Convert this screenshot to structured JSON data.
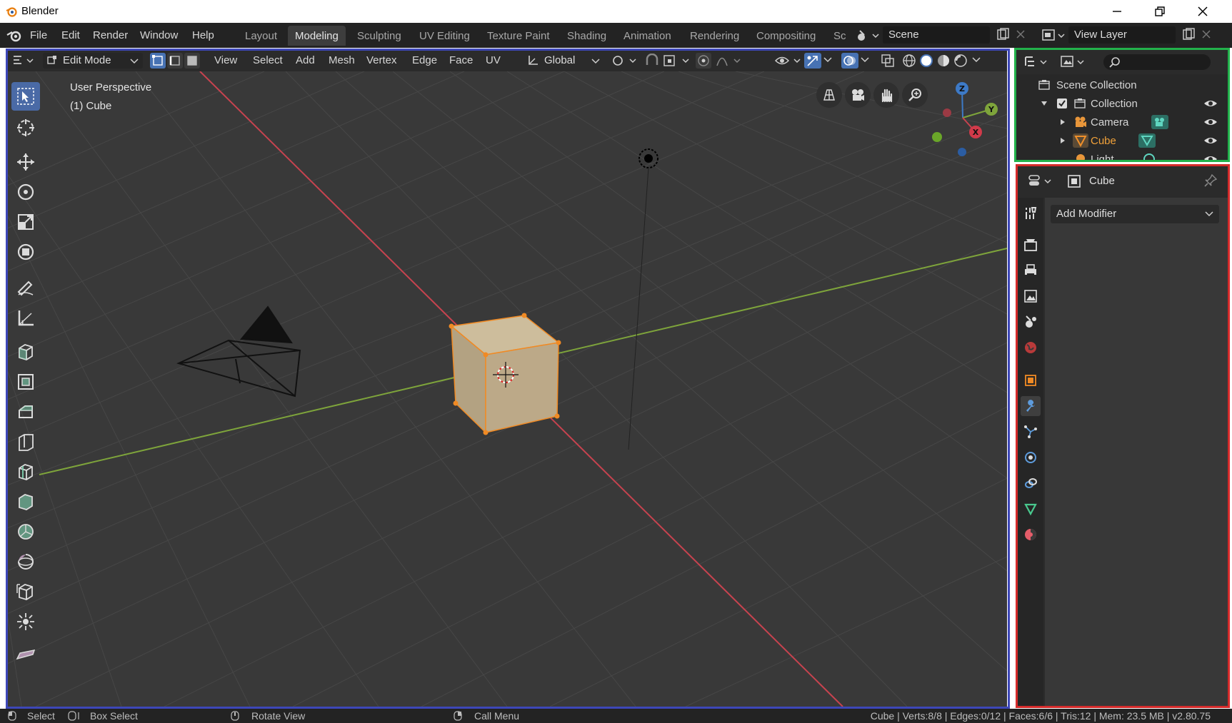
{
  "window": {
    "title": "Blender",
    "controls": [
      "minimize-icon",
      "restore-icon",
      "close-icon"
    ]
  },
  "menu": {
    "items": [
      "File",
      "Edit",
      "Render",
      "Window",
      "Help"
    ]
  },
  "workspaces": {
    "tabs": [
      "Layout",
      "Modeling",
      "Sculpting",
      "UV Editing",
      "Texture Paint",
      "Shading",
      "Animation",
      "Rendering",
      "Compositing",
      "Sc"
    ],
    "active": "Modeling"
  },
  "scene": {
    "name": "Scene"
  },
  "view_layer": {
    "name": "View Layer"
  },
  "viewport_header": {
    "mode": "Edit Mode",
    "menus": [
      "View",
      "Select",
      "Add",
      "Mesh",
      "Vertex",
      "Edge",
      "Face",
      "UV"
    ],
    "orientation": "Global"
  },
  "viewport": {
    "perspective": "User Perspective",
    "object_label": "(1) Cube",
    "gizmo_axes": [
      "Z",
      "Y",
      "X"
    ],
    "colors": {
      "background": "#393939",
      "x_axis": "#c7434f",
      "y_axis": "#7ea43b",
      "cube": "#b9a98a",
      "selection": "#f08a24",
      "frame": "#3d47b8"
    }
  },
  "outliner": {
    "root": "Scene Collection",
    "collection": "Collection",
    "objects": [
      "Camera",
      "Cube",
      "Light"
    ],
    "frame_color": "#22b24b"
  },
  "properties": {
    "object_name": "Cube",
    "add_modifier": "Add Modifier",
    "frame_color": "#d42a2a",
    "tabs": [
      "tool-icon",
      "render-icon",
      "output-icon",
      "view-layer-icon",
      "scene-icon",
      "world-icon",
      "object-icon",
      "modifier-icon",
      "particles-icon",
      "physics-icon",
      "constraints-icon",
      "data-icon",
      "material-icon"
    ]
  },
  "statusbar": {
    "select": "Select",
    "box_select": "Box Select",
    "rotate_view": "Rotate View",
    "call_menu": "Call Menu",
    "stats": "Cube | Verts:8/8 | Edges:0/12 | Faces:6/6 | Tris:12 | Mem: 23.5 MB | v2.80.75"
  }
}
